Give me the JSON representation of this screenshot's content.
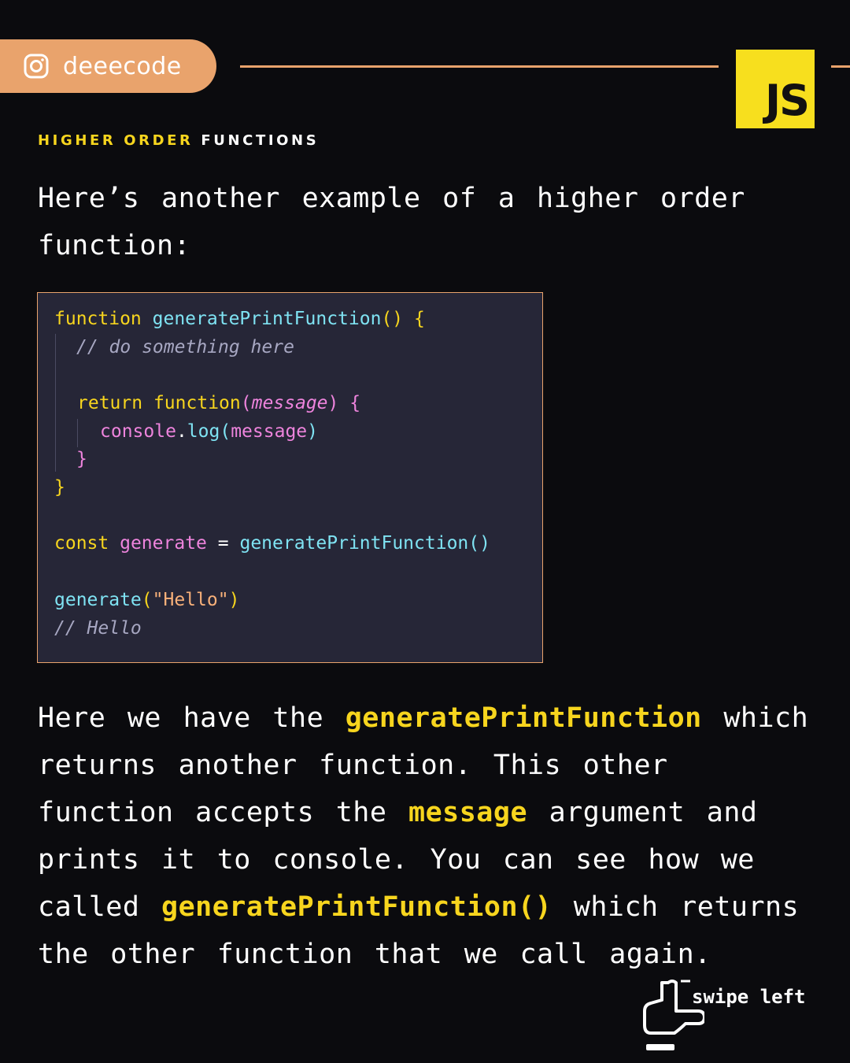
{
  "header": {
    "handle": "deeecode",
    "badge": "JS",
    "eyebrow_part1": "HIGHER ORDER",
    "eyebrow_part2": "FUNCTIONS"
  },
  "intro": "Here’s another example of a higher order function:",
  "code": {
    "l1_kw": "function",
    "l1_fn": "generatePrintFunction",
    "l1_rest": "() {",
    "l2_cmt": "// do something here",
    "l3_kw": "return",
    "l3_fn": "function",
    "l3_open": "(",
    "l3_param": "message",
    "l3_close": ") {",
    "l4_obj": "console",
    "l4_dot": ".",
    "l4_fn": "log",
    "l4_open": "(",
    "l4_arg": "message",
    "l4_close": ")",
    "l5": "}",
    "l6": "}",
    "l7_kw": "const",
    "l7_var": "generate",
    "l7_eq": "=",
    "l7_fn": "generatePrintFunction",
    "l7_paren": "()",
    "l8_fn": "generate",
    "l8_open": "(",
    "l8_str": "\"Hello\"",
    "l8_close": ")",
    "l9_cmt": "// Hello"
  },
  "body": {
    "t1": "Here we have the ",
    "h1": "generatePrintFunction",
    "t2": " which returns another function. This other function accepts the ",
    "h2": "message",
    "t3": " argument and prints it to console. You can see how we called ",
    "h3": "generatePrintFunction()",
    "t4": " which returns the other function that we call again."
  },
  "swipe": {
    "label": "swipe left"
  },
  "colors": {
    "accent": "#e9a36c",
    "js_yellow": "#f7df1e",
    "highlight": "#f7d51e",
    "background": "#0b0b0e",
    "code_bg": "#262637"
  },
  "icons": [
    "instagram-icon",
    "swipe-hand-icon"
  ]
}
